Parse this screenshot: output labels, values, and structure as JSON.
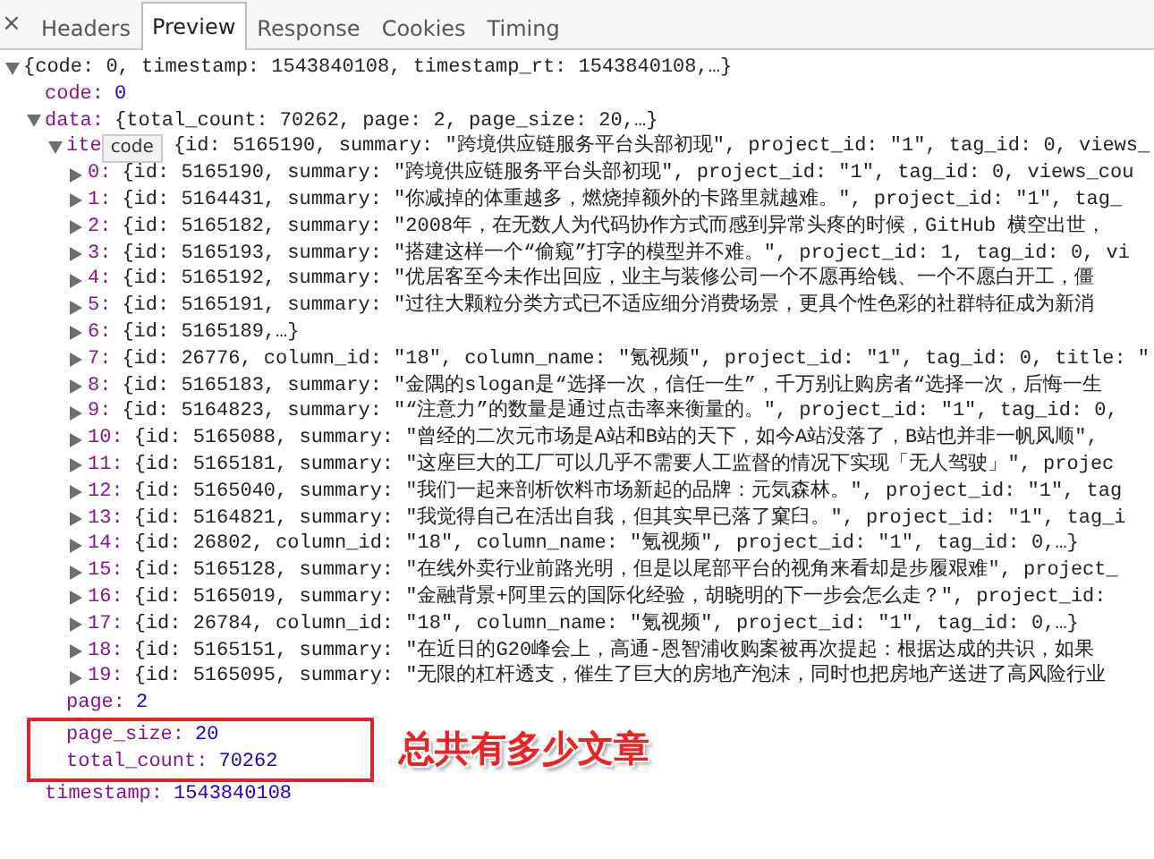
{
  "close_button": {
    "label": "×"
  },
  "tabs": [
    {
      "label": "Headers",
      "selected": false
    },
    {
      "label": "Preview",
      "selected": true
    },
    {
      "label": "Response",
      "selected": false
    },
    {
      "label": "Cookies",
      "selected": false
    },
    {
      "label": "Timing",
      "selected": false
    }
  ],
  "tree": {
    "value": "{code: 0, timestamp: 1543840108, timestamp_rt: 1543840108,…}",
    "kind": "object",
    "expanded": true,
    "children": [
      {
        "key": "code:",
        "value": "0",
        "kind": "number"
      },
      {
        "key": "data:",
        "value": "{total_count: 70262, page: 2, page_size: 20,…}",
        "kind": "object",
        "expanded": true,
        "children": [
          {
            "key": "ite",
            "tooltip": "code",
            "value": "{id: 5165190, summary: \"跨境供应链服务平台头部初现\", project_id: \"1\", tag_id: 0, views_",
            "kind": "object",
            "expanded": true,
            "highlighted": false,
            "children": [
              {
                "key": "0:",
                "value": "{id: 5165190, summary: \"跨境供应链服务平台头部初现\", project_id: \"1\", tag_id: 0, views_cou",
                "kind": "object",
                "expanded": false
              },
              {
                "key": "1:",
                "value": "{id: 5164431, summary: \"你减掉的体重越多，燃烧掉额外的卡路里就越难。\", project_id: \"1\", tag_",
                "kind": "object",
                "expanded": false
              },
              {
                "key": "2:",
                "value": "{id: 5165182, summary: \"2008年，在无数人为代码协作方式而感到异常头疼的时候，GitHub 横空出世，",
                "kind": "object",
                "expanded": false
              },
              {
                "key": "3:",
                "value": "{id: 5165193, summary: \"搭建这样一个“偷窥”打字的模型并不难。\", project_id: 1, tag_id: 0, vi",
                "kind": "object",
                "expanded": false
              },
              {
                "key": "4:",
                "value": "{id: 5165192, summary: \"优居客至今未作出回应，业主与装修公司一个不愿再给钱、一个不愿白开工，僵",
                "kind": "object",
                "expanded": false
              },
              {
                "key": "5:",
                "value": "{id: 5165191, summary: \"过往大颗粒分类方式已不适应细分消费场景，更具个性色彩的社群特征成为新消",
                "kind": "object",
                "expanded": false
              },
              {
                "key": "6:",
                "value": "{id: 5165189,…}",
                "kind": "object",
                "expanded": false
              },
              {
                "key": "7:",
                "value": "{id: 26776, column_id: \"18\", column_name: \"氪视频\", project_id: \"1\", tag_id: 0, title: \"",
                "kind": "object",
                "expanded": false
              },
              {
                "key": "8:",
                "value": "{id: 5165183, summary: \"金隅的slogan是“选择一次，信任一生”，千万别让购房者“选择一次，后悔一生",
                "kind": "object",
                "expanded": false
              },
              {
                "key": "9:",
                "value": "{id: 5164823, summary: \"“注意力”的数量是通过点击率来衡量的。\", project_id: \"1\", tag_id: 0,",
                "kind": "object",
                "expanded": false
              },
              {
                "key": "10:",
                "value": "{id: 5165088, summary: \"曾经的二次元市场是A站和B站的天下，如今A站没落了，B站也并非一帆风顺\",",
                "kind": "object",
                "expanded": false
              },
              {
                "key": "11:",
                "value": "{id: 5165181, summary: \"这座巨大的工厂可以几乎不需要人工监督的情况下实现「无人驾驶」\", projec",
                "kind": "object",
                "expanded": false
              },
              {
                "key": "12:",
                "value": "{id: 5165040, summary: \"我们一起来剖析饮料市场新起的品牌：元気森林。\", project_id: \"1\", tag",
                "kind": "object",
                "expanded": false
              },
              {
                "key": "13:",
                "value": "{id: 5164821, summary: \"我觉得自己在活出自我，但其实早已落了窠臼。\", project_id: \"1\", tag_i",
                "kind": "object",
                "expanded": false
              },
              {
                "key": "14:",
                "value": "{id: 26802, column_id: \"18\", column_name: \"氪视频\", project_id: \"1\", tag_id: 0,…}",
                "kind": "object",
                "expanded": false
              },
              {
                "key": "15:",
                "value": "{id: 5165128, summary: \"在线外卖行业前路光明，但是以尾部平台的视角来看却是步履艰难\", project_",
                "kind": "object",
                "expanded": false
              },
              {
                "key": "16:",
                "value": "{id: 5165019, summary: \"金融背景+阿里云的国际化经验，胡晓明的下一步会怎么走？\", project_id:",
                "kind": "object",
                "expanded": false
              },
              {
                "key": "17:",
                "value": "{id: 26784, column_id: \"18\", column_name: \"氪视频\", project_id: \"1\", tag_id: 0,…}",
                "kind": "object",
                "expanded": false
              },
              {
                "key": "18:",
                "value": "{id: 5165151, summary: \"在近日的G20峰会上，高通-恩智浦收购案被再次提起：根据达成的共识，如果",
                "kind": "object",
                "expanded": false
              },
              {
                "key": "19:",
                "value": "{id: 5165095, summary: \"无限的杠杆透支，催生了巨大的房地产泡沫，同时也把房地产送进了高风险行业",
                "kind": "object",
                "expanded": false
              }
            ]
          },
          {
            "key": "page:",
            "value": "2",
            "kind": "number",
            "highlighted": false
          },
          {
            "key": "page_size:",
            "value": "20",
            "kind": "number",
            "highlighted": true
          },
          {
            "key": "total_count:",
            "value": "70262",
            "kind": "number",
            "highlighted": true
          }
        ]
      },
      {
        "key": "timestamp:",
        "value": "1543840108",
        "kind": "number"
      }
    ]
  },
  "annotation": {
    "text": "总共有多少文章"
  }
}
